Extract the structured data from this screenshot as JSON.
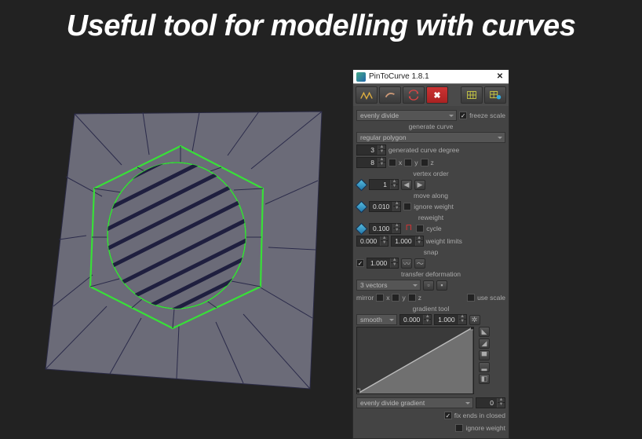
{
  "headline": "Useful tool for modelling with curves",
  "panel": {
    "title": "PinToCurve 1.8.1",
    "divide_mode": "evenly divide",
    "freeze_scale": "freeze scale",
    "generate_curve_label": "generate curve",
    "curve_type": "regular polygon",
    "degree_value": "3",
    "degree_label": "generated curve degree",
    "sides_value": "8",
    "axis_x": "x",
    "axis_y": "y",
    "axis_z": "z",
    "vertex_order_label": "vertex order",
    "vertex_order_value": "1",
    "move_along_label": "move along",
    "move_along_value": "0.010",
    "ignore_weight_label": "ignore weight",
    "reweight_label": "reweight",
    "reweight_value": "0.100",
    "cycle_label": "cycle",
    "wlimit_min": "0.000",
    "wlimit_max": "1.000",
    "weight_limits_label": "weight limits",
    "snap_label": "snap",
    "snap_value": "1.000",
    "transfer_deformation_label": "transfer deformation",
    "vectors_dd": "3 vectors",
    "mirror_label": "mirror",
    "use_scale_label": "use scale",
    "gradient_tool_label": "gradient tool",
    "gradient_mode": "smooth",
    "grad_min": "0.000",
    "grad_max": "1.000",
    "gradient_divide": "evenly divide gradient",
    "grad_count": "0",
    "fix_ends_label": "fix ends in closed",
    "ignore_weight2_label": "ignore weight"
  }
}
